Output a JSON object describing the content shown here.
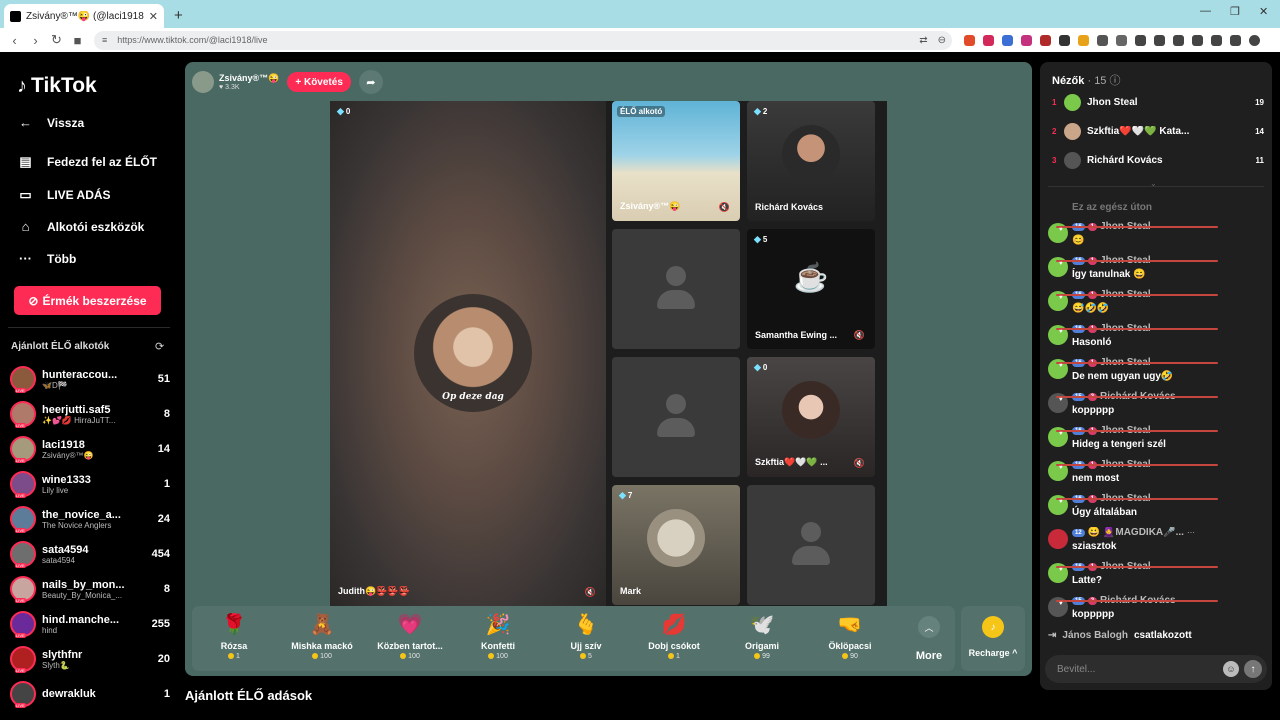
{
  "browser": {
    "tab_title": "Zsivány®™😜 (@laci1918) ÉL...",
    "url_prefix": "≡",
    "url": "https://www.tiktok.com/@laci1918/live"
  },
  "sidebar": {
    "logo": "TikTok",
    "back": "Vissza",
    "menu": [
      "Fedezd fel az ÉLŐT",
      "LIVE ADÁS",
      "Alkotói eszközök",
      "Több"
    ],
    "coins_button": "Érmék beszerzése",
    "recommended_title": "Ajánlott ÉLŐ alkotók",
    "creators": [
      {
        "name": "hunteraccou...",
        "sub": "🦋D🏁",
        "count": "51",
        "color": "#8b5a3c"
      },
      {
        "name": "heerjutti.saf5",
        "sub": "✨💕💋 HirraJuTT...",
        "count": "8",
        "color": "#b07a6a"
      },
      {
        "name": "laci1918",
        "sub": "Zsivány®™😜",
        "count": "14",
        "color": "#a59a7c"
      },
      {
        "name": "wine1333",
        "sub": "Lily live",
        "count": "1",
        "color": "#7b4b8a"
      },
      {
        "name": "the_novice_a...",
        "sub": "The Novice Anglers",
        "count": "24",
        "color": "#5c7c9a"
      },
      {
        "name": "sata4594",
        "sub": "sata4594",
        "count": "454",
        "color": "#6e6e6e"
      },
      {
        "name": "nails_by_mon...",
        "sub": "Beauty_By_Monica_...",
        "count": "8",
        "color": "#c9a5a0"
      },
      {
        "name": "hind.manche...",
        "sub": "hind",
        "count": "255",
        "color": "#6a2a9a"
      },
      {
        "name": "slythfnr",
        "sub": "Slyth🐍",
        "count": "20",
        "color": "#b02020"
      },
      {
        "name": "dewrakluk",
        "sub": "",
        "count": "1",
        "color": "#444"
      }
    ]
  },
  "live": {
    "host_name": "Zsivány®™😜",
    "host_likes": "♥ 3.3K",
    "follow_button": "+ Követés",
    "big_tile": {
      "count": "0",
      "name": "Judith😜👺👺👺",
      "overlay_text": "Op deze dag"
    },
    "tiles": [
      {
        "label": "ÉLŐ alkotó",
        "name": "Zsivány®™😜",
        "count": ""
      },
      {
        "name": "Richárd Kovács",
        "count": "2"
      },
      {
        "name": "",
        "count": ""
      },
      {
        "name": "Samantha Ewing ...",
        "count": "5"
      },
      {
        "name": "",
        "count": ""
      },
      {
        "name": "Szkftia❤️🤍💚 ...",
        "count": "0"
      },
      {
        "name": "Mark",
        "count": "7"
      },
      {
        "name": "",
        "count": ""
      }
    ]
  },
  "gifts": [
    {
      "name": "Rózsa",
      "price": "1",
      "icon": "🌹"
    },
    {
      "name": "Mishka mackó",
      "price": "100",
      "icon": "🧸"
    },
    {
      "name": "Közben tartot...",
      "price": "100",
      "icon": "💗"
    },
    {
      "name": "Konfetti",
      "price": "100",
      "icon": "🎉"
    },
    {
      "name": "Ujj szív",
      "price": "5",
      "icon": "🫰"
    },
    {
      "name": "Dobj csókot",
      "price": "1",
      "icon": "💋"
    },
    {
      "name": "Origami",
      "price": "99",
      "icon": "🕊️"
    },
    {
      "name": "Öklöpacsi",
      "price": "90",
      "icon": "🤜"
    }
  ],
  "more_label": "More",
  "recharge_label": "Recharge ^",
  "suggested_title": "Ajánlott ÉLŐ adások",
  "viewers": {
    "title": "Nézők",
    "count": "· 15",
    "list": [
      {
        "rank": "1",
        "name": "Jhon Steal",
        "score": "19",
        "color": "#7ac94a"
      },
      {
        "rank": "2",
        "name": "Szkftia❤️🤍💚 Kata...",
        "score": "14",
        "color": "#c9a58a"
      },
      {
        "rank": "3",
        "name": "Richárd Kovács",
        "score": "11",
        "color": "#555"
      }
    ]
  },
  "chat": {
    "faded": "Ez az egész úton",
    "messages": [
      {
        "lvl": "16",
        "fan": "1",
        "user": "Jhon Steal",
        "text": "😊",
        "color": "#7ac94a"
      },
      {
        "lvl": "16",
        "fan": "1",
        "user": "Jhon Steal",
        "text": "Így tanulnak 😄",
        "color": "#7ac94a"
      },
      {
        "lvl": "16",
        "fan": "1",
        "user": "Jhon Steal",
        "text": "😅🤣🤣",
        "color": "#7ac94a"
      },
      {
        "lvl": "16",
        "fan": "1",
        "user": "Jhon Steal",
        "text": "Hasonló",
        "color": "#7ac94a"
      },
      {
        "lvl": "16",
        "fan": "1",
        "user": "Jhon Steal",
        "text": "De nem ugyan ugy🤣",
        "color": "#7ac94a"
      },
      {
        "lvl": "15",
        "fan": "3",
        "user": "Richárd Kovács",
        "text": "koppppp",
        "color": "#555"
      },
      {
        "lvl": "16",
        "fan": "1",
        "user": "Jhon Steal",
        "text": "Hideg a tengeri szél",
        "color": "#7ac94a"
      },
      {
        "lvl": "16",
        "fan": "1",
        "user": "Jhon Steal",
        "text": "nem most",
        "color": "#7ac94a"
      },
      {
        "lvl": "16",
        "fan": "1",
        "user": "Jhon Steal",
        "text": "Úgy általában",
        "color": "#7ac94a"
      },
      {
        "lvl": "12",
        "fan": "",
        "user": "😀 🧕MAGDIKA🎤...",
        "text": "sziasztok",
        "color": "#c92a3a"
      },
      {
        "lvl": "16",
        "fan": "1",
        "user": "Jhon Steal",
        "text": "Latte?",
        "color": "#7ac94a"
      },
      {
        "lvl": "15",
        "fan": "2",
        "user": "Richárd Kovács",
        "text": "koppppp",
        "color": "#555"
      }
    ],
    "joined_user": "János Balogh",
    "joined_text": "csatlakozott",
    "input_placeholder": "Bevitel..."
  }
}
